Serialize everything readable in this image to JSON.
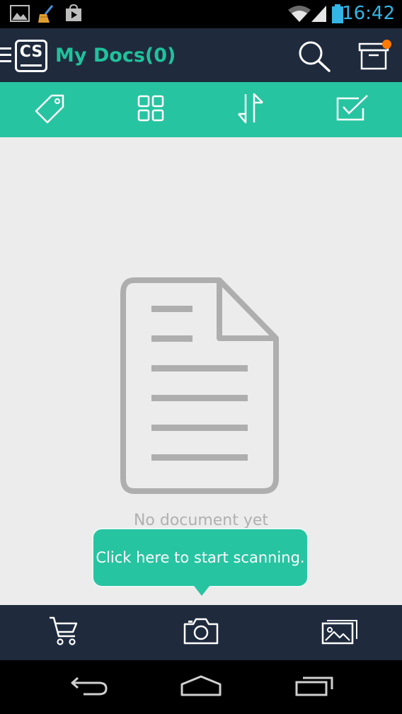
{
  "status_bar": {
    "time": "16:42",
    "icons": [
      "gallery-icon",
      "broom-icon",
      "play-store-icon",
      "wifi-icon",
      "signal-icon",
      "battery-icon"
    ]
  },
  "app_bar": {
    "logo_text": "CS",
    "title": "My Docs(0)",
    "icons": [
      "menu-icon",
      "search-icon",
      "archive-icon"
    ],
    "notification_dot_color": "#ff7a00"
  },
  "toolbar": {
    "icons": [
      "tag-icon",
      "grid-view-icon",
      "sort-icon",
      "select-icon"
    ]
  },
  "main": {
    "empty_text": "No document yet",
    "tooltip": "Click here to start scanning."
  },
  "bottom_bar": {
    "icons": [
      "cart-icon",
      "camera-icon",
      "import-image-icon"
    ]
  },
  "nav_bar": {
    "icons": [
      "back-icon",
      "home-icon",
      "recents-icon"
    ]
  },
  "colors": {
    "accent": "#27c4a1",
    "title": "#1fc29c",
    "dark": "#1f2a3d",
    "clock": "#33b5e5",
    "background": "#ececec"
  }
}
